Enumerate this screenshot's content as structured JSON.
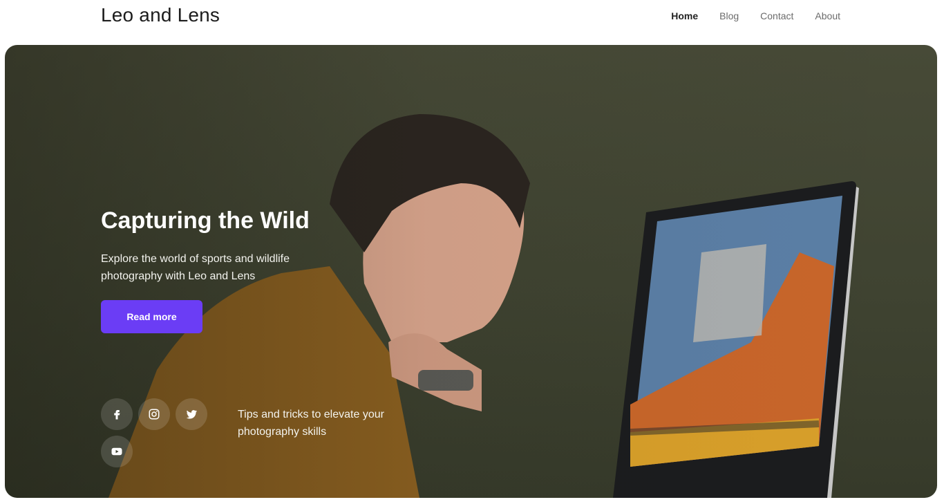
{
  "header": {
    "brand": "Leo and Lens",
    "nav": [
      {
        "label": "Home",
        "active": true
      },
      {
        "label": "Blog",
        "active": false
      },
      {
        "label": "Contact",
        "active": false
      },
      {
        "label": "About",
        "active": false
      }
    ]
  },
  "hero": {
    "title": "Capturing the Wild",
    "subtitle": "Explore the world of sports and wildlife photography with Leo and Lens",
    "cta_label": "Read more",
    "tagline": "Tips and tricks to elevate your photography skills",
    "background_image": "man-at-computer-photo"
  },
  "socials": [
    {
      "name": "facebook-icon"
    },
    {
      "name": "instagram-icon"
    },
    {
      "name": "twitter-icon"
    },
    {
      "name": "youtube-icon"
    }
  ],
  "colors": {
    "accent": "#6b3df5",
    "hero_bg": "#474a37",
    "nav_active": "#222222",
    "nav_inactive": "#6b6b6b"
  }
}
